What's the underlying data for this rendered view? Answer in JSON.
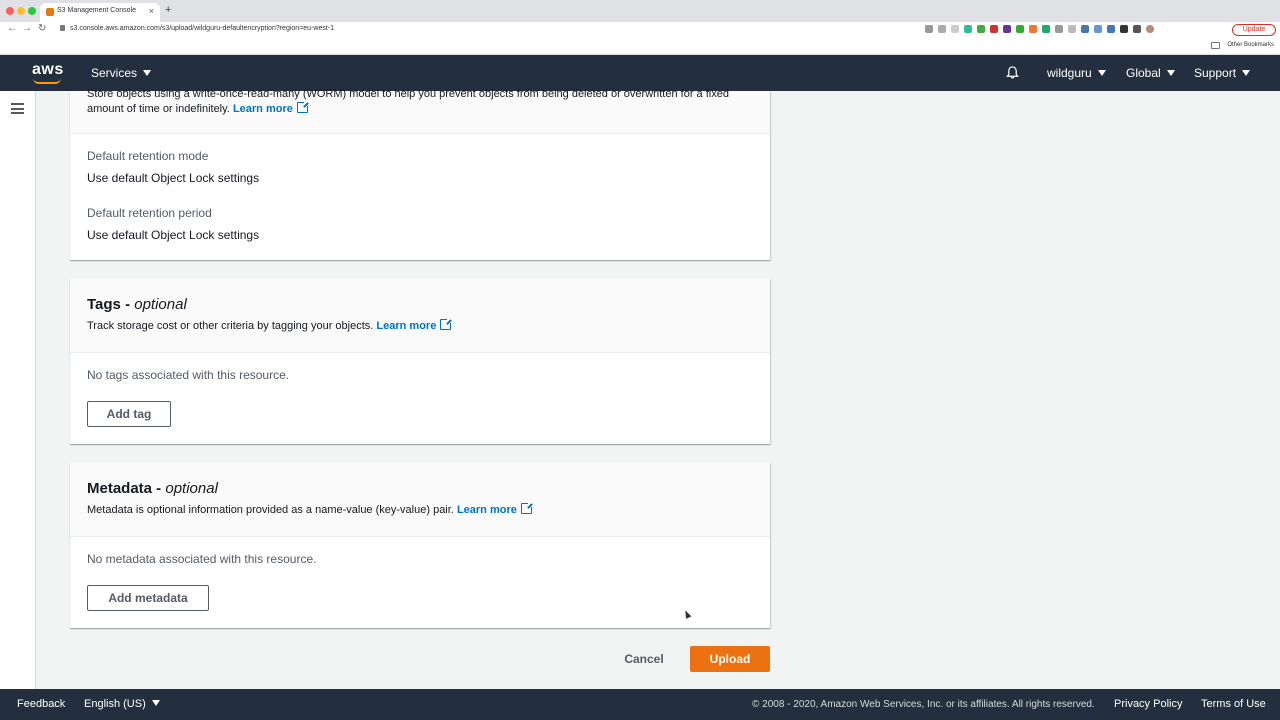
{
  "browser": {
    "tab_title": "S3 Management Console",
    "url": "s3.console.aws.amazon.com/s3/upload/wildguru-defaultencryption?region=eu-west-1",
    "update_label": "Update",
    "other_bookmarks": "Other Bookmarks"
  },
  "awsnav": {
    "logo": "aws",
    "services": "Services",
    "account": "wildguru",
    "region": "Global",
    "support": "Support"
  },
  "object_lock": {
    "description_line1": "Store objects using a write-once-read-many (WORM) model to help you prevent objects from being deleted or overwritten for a fixed",
    "description_line2": "amount of time or indefinitely.",
    "learn_more": "Learn more",
    "retention_mode_label": "Default retention mode",
    "retention_mode_value": "Use default Object Lock settings",
    "retention_period_label": "Default retention period",
    "retention_period_value": "Use default Object Lock settings"
  },
  "tags": {
    "title": "Tags - ",
    "title_suffix": "optional",
    "description": "Track storage cost or other criteria by tagging your objects.",
    "learn_more": "Learn more",
    "empty_text": "No tags associated with this resource.",
    "add_button": "Add tag"
  },
  "metadata": {
    "title": "Metadata - ",
    "title_suffix": "optional",
    "description": "Metadata is optional information provided as a name-value (key-value) pair.",
    "learn_more": "Learn more",
    "empty_text": "No metadata associated with this resource.",
    "add_button": "Add metadata"
  },
  "actions": {
    "cancel": "Cancel",
    "upload": "Upload"
  },
  "footer": {
    "feedback": "Feedback",
    "language": "English (US)",
    "copyright": "© 2008 - 2020, Amazon Web Services, Inc. or its affiliates. All rights reserved.",
    "privacy": "Privacy Policy",
    "terms": "Terms of Use"
  },
  "colors": {
    "nav_bg": "#232f3e",
    "accent": "#ec7211",
    "link": "#0073bb"
  }
}
